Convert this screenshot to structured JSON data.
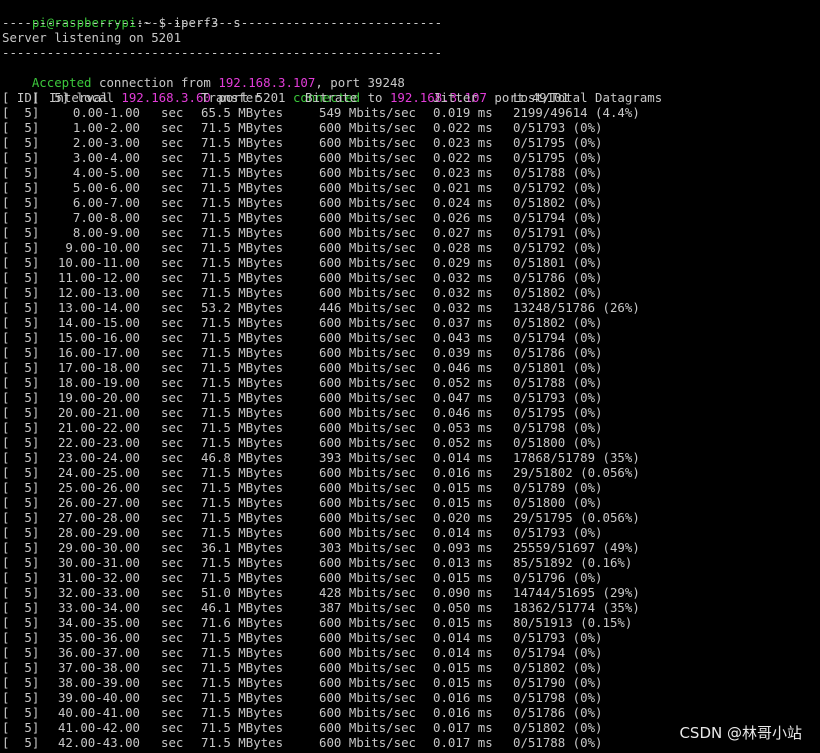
{
  "colors": {
    "background": "#000000",
    "text": "#c8c8c8",
    "green": "#3cc83c",
    "magenta": "#e23cd8"
  },
  "prompt": {
    "user_host": "pi@raspberrypi",
    "path_sep": ":~ $ ",
    "command": "iperf3 -s"
  },
  "separator": "-----------------------------------------------------------",
  "listening": "Server listening on 5201",
  "accepted": {
    "label": "Accepted",
    "text1": " connection from ",
    "ip": "192.168.3.107",
    "text2": ", port 39248"
  },
  "connection": {
    "prefix": "[  5] local ",
    "local_ip": "192.168.3.60",
    "mid": " port 5201 ",
    "status": "connected",
    "to": " to ",
    "remote_ip": "192.168.3.107",
    "suffix": " port 49101"
  },
  "header": {
    "id": "[ ID]",
    "interval": "Interval",
    "transfer": "Transfer",
    "bitrate": "Bitrate",
    "jitter": "Jitter",
    "lost": "Lost/Total Datagrams"
  },
  "rows": [
    {
      "id": "[  5]",
      "interval": "0.00-1.00",
      "unit": "sec",
      "transfer": "65.5 MBytes",
      "bitrate": "549 Mbits/sec",
      "jitter": "0.019 ms",
      "lost": "2199/49614 (4.4%)"
    },
    {
      "id": "[  5]",
      "interval": "1.00-2.00",
      "unit": "sec",
      "transfer": "71.5 MBytes",
      "bitrate": "600 Mbits/sec",
      "jitter": "0.022 ms",
      "lost": "0/51793 (0%)"
    },
    {
      "id": "[  5]",
      "interval": "2.00-3.00",
      "unit": "sec",
      "transfer": "71.5 MBytes",
      "bitrate": "600 Mbits/sec",
      "jitter": "0.023 ms",
      "lost": "0/51795 (0%)"
    },
    {
      "id": "[  5]",
      "interval": "3.00-4.00",
      "unit": "sec",
      "transfer": "71.5 MBytes",
      "bitrate": "600 Mbits/sec",
      "jitter": "0.022 ms",
      "lost": "0/51795 (0%)"
    },
    {
      "id": "[  5]",
      "interval": "4.00-5.00",
      "unit": "sec",
      "transfer": "71.5 MBytes",
      "bitrate": "600 Mbits/sec",
      "jitter": "0.023 ms",
      "lost": "0/51788 (0%)"
    },
    {
      "id": "[  5]",
      "interval": "5.00-6.00",
      "unit": "sec",
      "transfer": "71.5 MBytes",
      "bitrate": "600 Mbits/sec",
      "jitter": "0.021 ms",
      "lost": "0/51792 (0%)"
    },
    {
      "id": "[  5]",
      "interval": "6.00-7.00",
      "unit": "sec",
      "transfer": "71.5 MBytes",
      "bitrate": "600 Mbits/sec",
      "jitter": "0.024 ms",
      "lost": "0/51802 (0%)"
    },
    {
      "id": "[  5]",
      "interval": "7.00-8.00",
      "unit": "sec",
      "transfer": "71.5 MBytes",
      "bitrate": "600 Mbits/sec",
      "jitter": "0.026 ms",
      "lost": "0/51794 (0%)"
    },
    {
      "id": "[  5]",
      "interval": "8.00-9.00",
      "unit": "sec",
      "transfer": "71.5 MBytes",
      "bitrate": "600 Mbits/sec",
      "jitter": "0.027 ms",
      "lost": "0/51791 (0%)"
    },
    {
      "id": "[  5]",
      "interval": "9.00-10.00",
      "unit": "sec",
      "transfer": "71.5 MBytes",
      "bitrate": "600 Mbits/sec",
      "jitter": "0.028 ms",
      "lost": "0/51792 (0%)"
    },
    {
      "id": "[  5]",
      "interval": "10.00-11.00",
      "unit": "sec",
      "transfer": "71.5 MBytes",
      "bitrate": "600 Mbits/sec",
      "jitter": "0.029 ms",
      "lost": "0/51801 (0%)"
    },
    {
      "id": "[  5]",
      "interval": "11.00-12.00",
      "unit": "sec",
      "transfer": "71.5 MBytes",
      "bitrate": "600 Mbits/sec",
      "jitter": "0.032 ms",
      "lost": "0/51786 (0%)"
    },
    {
      "id": "[  5]",
      "interval": "12.00-13.00",
      "unit": "sec",
      "transfer": "71.5 MBytes",
      "bitrate": "600 Mbits/sec",
      "jitter": "0.032 ms",
      "lost": "0/51802 (0%)"
    },
    {
      "id": "[  5]",
      "interval": "13.00-14.00",
      "unit": "sec",
      "transfer": "53.2 MBytes",
      "bitrate": "446 Mbits/sec",
      "jitter": "0.032 ms",
      "lost": "13248/51786 (26%)"
    },
    {
      "id": "[  5]",
      "interval": "14.00-15.00",
      "unit": "sec",
      "transfer": "71.5 MBytes",
      "bitrate": "600 Mbits/sec",
      "jitter": "0.037 ms",
      "lost": "0/51802 (0%)"
    },
    {
      "id": "[  5]",
      "interval": "15.00-16.00",
      "unit": "sec",
      "transfer": "71.5 MBytes",
      "bitrate": "600 Mbits/sec",
      "jitter": "0.043 ms",
      "lost": "0/51794 (0%)"
    },
    {
      "id": "[  5]",
      "interval": "16.00-17.00",
      "unit": "sec",
      "transfer": "71.5 MBytes",
      "bitrate": "600 Mbits/sec",
      "jitter": "0.039 ms",
      "lost": "0/51786 (0%)"
    },
    {
      "id": "[  5]",
      "interval": "17.00-18.00",
      "unit": "sec",
      "transfer": "71.5 MBytes",
      "bitrate": "600 Mbits/sec",
      "jitter": "0.046 ms",
      "lost": "0/51801 (0%)"
    },
    {
      "id": "[  5]",
      "interval": "18.00-19.00",
      "unit": "sec",
      "transfer": "71.5 MBytes",
      "bitrate": "600 Mbits/sec",
      "jitter": "0.052 ms",
      "lost": "0/51788 (0%)"
    },
    {
      "id": "[  5]",
      "interval": "19.00-20.00",
      "unit": "sec",
      "transfer": "71.5 MBytes",
      "bitrate": "600 Mbits/sec",
      "jitter": "0.047 ms",
      "lost": "0/51793 (0%)"
    },
    {
      "id": "[  5]",
      "interval": "20.00-21.00",
      "unit": "sec",
      "transfer": "71.5 MBytes",
      "bitrate": "600 Mbits/sec",
      "jitter": "0.046 ms",
      "lost": "0/51795 (0%)"
    },
    {
      "id": "[  5]",
      "interval": "21.00-22.00",
      "unit": "sec",
      "transfer": "71.5 MBytes",
      "bitrate": "600 Mbits/sec",
      "jitter": "0.053 ms",
      "lost": "0/51798 (0%)"
    },
    {
      "id": "[  5]",
      "interval": "22.00-23.00",
      "unit": "sec",
      "transfer": "71.5 MBytes",
      "bitrate": "600 Mbits/sec",
      "jitter": "0.052 ms",
      "lost": "0/51800 (0%)"
    },
    {
      "id": "[  5]",
      "interval": "23.00-24.00",
      "unit": "sec",
      "transfer": "46.8 MBytes",
      "bitrate": "393 Mbits/sec",
      "jitter": "0.014 ms",
      "lost": "17868/51789 (35%)"
    },
    {
      "id": "[  5]",
      "interval": "24.00-25.00",
      "unit": "sec",
      "transfer": "71.5 MBytes",
      "bitrate": "600 Mbits/sec",
      "jitter": "0.016 ms",
      "lost": "29/51802 (0.056%)"
    },
    {
      "id": "[  5]",
      "interval": "25.00-26.00",
      "unit": "sec",
      "transfer": "71.5 MBytes",
      "bitrate": "600 Mbits/sec",
      "jitter": "0.015 ms",
      "lost": "0/51789 (0%)"
    },
    {
      "id": "[  5]",
      "interval": "26.00-27.00",
      "unit": "sec",
      "transfer": "71.5 MBytes",
      "bitrate": "600 Mbits/sec",
      "jitter": "0.015 ms",
      "lost": "0/51800 (0%)"
    },
    {
      "id": "[  5]",
      "interval": "27.00-28.00",
      "unit": "sec",
      "transfer": "71.5 MBytes",
      "bitrate": "600 Mbits/sec",
      "jitter": "0.020 ms",
      "lost": "29/51795 (0.056%)"
    },
    {
      "id": "[  5]",
      "interval": "28.00-29.00",
      "unit": "sec",
      "transfer": "71.5 MBytes",
      "bitrate": "600 Mbits/sec",
      "jitter": "0.014 ms",
      "lost": "0/51793 (0%)"
    },
    {
      "id": "[  5]",
      "interval": "29.00-30.00",
      "unit": "sec",
      "transfer": "36.1 MBytes",
      "bitrate": "303 Mbits/sec",
      "jitter": "0.093 ms",
      "lost": "25559/51697 (49%)"
    },
    {
      "id": "[  5]",
      "interval": "30.00-31.00",
      "unit": "sec",
      "transfer": "71.5 MBytes",
      "bitrate": "600 Mbits/sec",
      "jitter": "0.013 ms",
      "lost": "85/51892 (0.16%)"
    },
    {
      "id": "[  5]",
      "interval": "31.00-32.00",
      "unit": "sec",
      "transfer": "71.5 MBytes",
      "bitrate": "600 Mbits/sec",
      "jitter": "0.015 ms",
      "lost": "0/51796 (0%)"
    },
    {
      "id": "[  5]",
      "interval": "32.00-33.00",
      "unit": "sec",
      "transfer": "51.0 MBytes",
      "bitrate": "428 Mbits/sec",
      "jitter": "0.090 ms",
      "lost": "14744/51695 (29%)"
    },
    {
      "id": "[  5]",
      "interval": "33.00-34.00",
      "unit": "sec",
      "transfer": "46.1 MBytes",
      "bitrate": "387 Mbits/sec",
      "jitter": "0.050 ms",
      "lost": "18362/51774 (35%)"
    },
    {
      "id": "[  5]",
      "interval": "34.00-35.00",
      "unit": "sec",
      "transfer": "71.6 MBytes",
      "bitrate": "600 Mbits/sec",
      "jitter": "0.015 ms",
      "lost": "80/51913 (0.15%)"
    },
    {
      "id": "[  5]",
      "interval": "35.00-36.00",
      "unit": "sec",
      "transfer": "71.5 MBytes",
      "bitrate": "600 Mbits/sec",
      "jitter": "0.014 ms",
      "lost": "0/51793 (0%)"
    },
    {
      "id": "[  5]",
      "interval": "36.00-37.00",
      "unit": "sec",
      "transfer": "71.5 MBytes",
      "bitrate": "600 Mbits/sec",
      "jitter": "0.014 ms",
      "lost": "0/51794 (0%)"
    },
    {
      "id": "[  5]",
      "interval": "37.00-38.00",
      "unit": "sec",
      "transfer": "71.5 MBytes",
      "bitrate": "600 Mbits/sec",
      "jitter": "0.015 ms",
      "lost": "0/51802 (0%)"
    },
    {
      "id": "[  5]",
      "interval": "38.00-39.00",
      "unit": "sec",
      "transfer": "71.5 MBytes",
      "bitrate": "600 Mbits/sec",
      "jitter": "0.015 ms",
      "lost": "0/51790 (0%)"
    },
    {
      "id": "[  5]",
      "interval": "39.00-40.00",
      "unit": "sec",
      "transfer": "71.5 MBytes",
      "bitrate": "600 Mbits/sec",
      "jitter": "0.016 ms",
      "lost": "0/51798 (0%)"
    },
    {
      "id": "[  5]",
      "interval": "40.00-41.00",
      "unit": "sec",
      "transfer": "71.5 MBytes",
      "bitrate": "600 Mbits/sec",
      "jitter": "0.016 ms",
      "lost": "0/51786 (0%)"
    },
    {
      "id": "[  5]",
      "interval": "41.00-42.00",
      "unit": "sec",
      "transfer": "71.5 MBytes",
      "bitrate": "600 Mbits/sec",
      "jitter": "0.017 ms",
      "lost": "0/51802 (0%)"
    },
    {
      "id": "[  5]",
      "interval": "42.00-43.00",
      "unit": "sec",
      "transfer": "71.5 MBytes",
      "bitrate": "600 Mbits/sec",
      "jitter": "0.017 ms",
      "lost": "0/51788 (0%)"
    }
  ],
  "watermark": "CSDN @林哥小站"
}
